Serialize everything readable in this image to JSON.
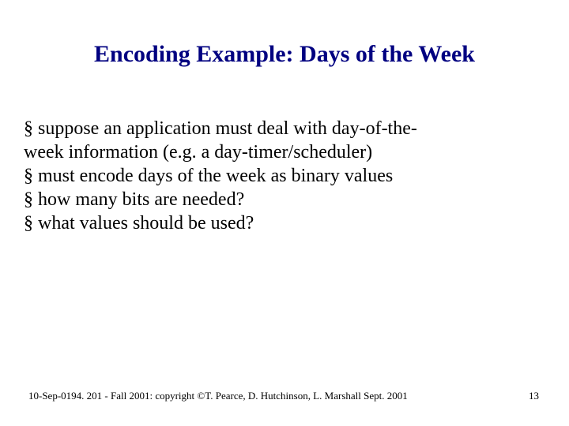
{
  "title": "Encoding Example: Days of the Week",
  "bullets": {
    "b1_part1": "suppose an application must deal with day-of-the-",
    "b1_part2": "week information (e.g. a day-timer/scheduler)",
    "b2": "must encode days of the week as binary values",
    "b3": "how many bits are needed?",
    "b4": "what values should be used?"
  },
  "bullet_char": "§",
  "footer": "10-Sep-0194. 201 - Fall 2001: copyright ©T. Pearce, D. Hutchinson, L. Marshall Sept. 2001",
  "page_number": "13"
}
